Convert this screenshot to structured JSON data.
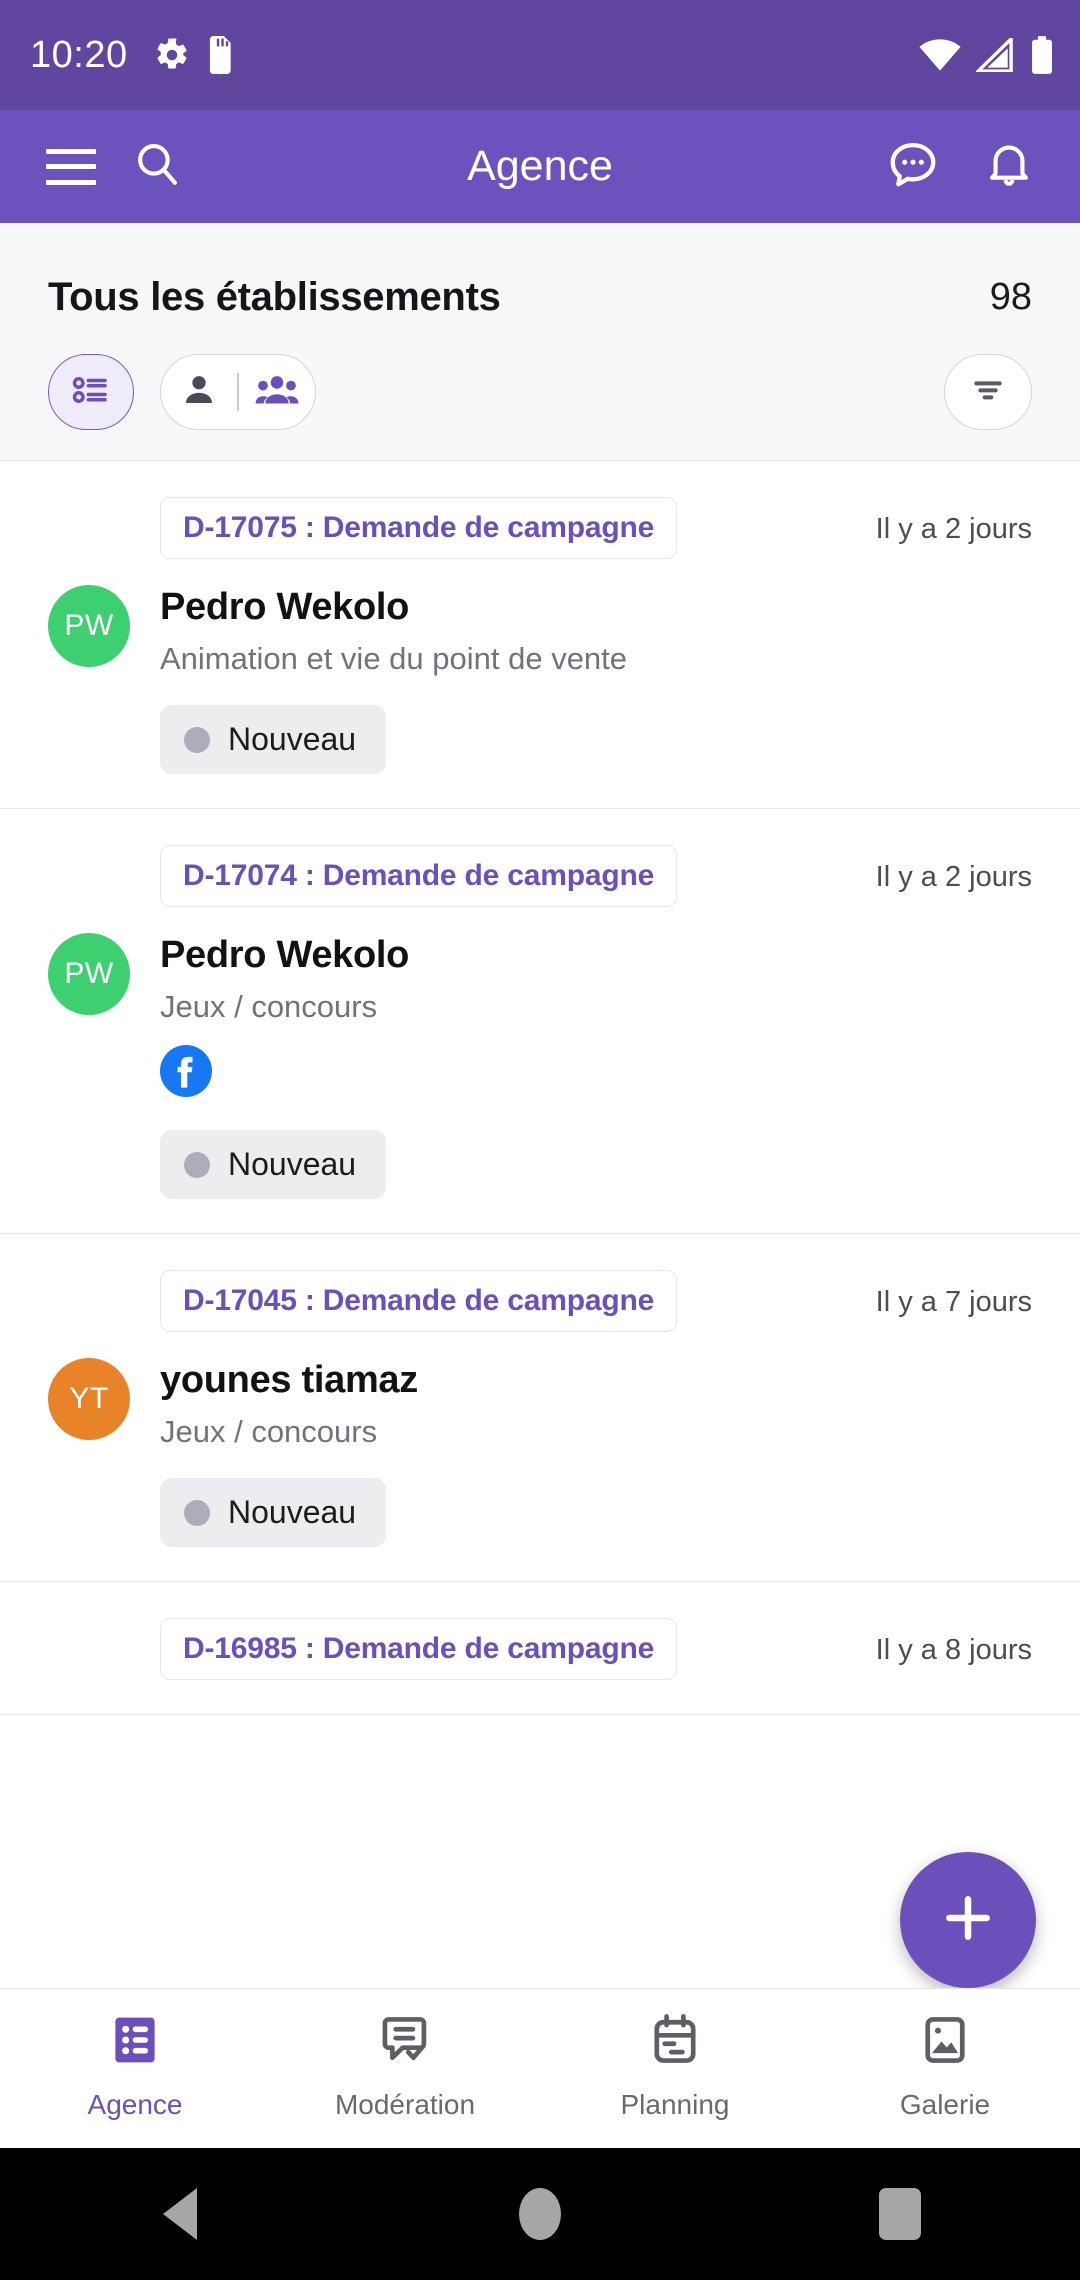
{
  "status_bar": {
    "time": "10:20",
    "icons": [
      "settings-gear-icon",
      "sd-card-icon"
    ],
    "right_icons": [
      "wifi-icon",
      "cellular-signal-icon",
      "battery-icon"
    ]
  },
  "app_bar": {
    "title": "Agence",
    "menu_icon": "hamburger-menu-icon",
    "search_icon": "search-icon",
    "chat_icon": "chat-bubble-icon",
    "notifications_icon": "bell-icon"
  },
  "list_header": {
    "title": "Tous les établissements",
    "count": "98",
    "chips": {
      "listview_icon": "list-view-icon",
      "person_icon": "person-icon",
      "group_icon": "group-icon",
      "filter_icon": "filter-sort-icon"
    }
  },
  "items": [
    {
      "reference": "D-17075 : Demande de campagne",
      "time": "Il y a 2 jours",
      "avatar_initials": "PW",
      "avatar_color": "#3ECF70",
      "name": "Pedro Wekolo",
      "category": "Animation et vie du point de vente",
      "socials": [],
      "status": "Nouveau",
      "status_color": "#ADADBA"
    },
    {
      "reference": "D-17074 : Demande de campagne",
      "time": "Il y a 2 jours",
      "avatar_initials": "PW",
      "avatar_color": "#3ECF70",
      "name": "Pedro Wekolo",
      "category": "Jeux / concours",
      "socials": [
        "facebook-icon"
      ],
      "status": "Nouveau",
      "status_color": "#ADADBA"
    },
    {
      "reference": "D-17045 : Demande de campagne",
      "time": "Il y a 7 jours",
      "avatar_initials": "YT",
      "avatar_color": "#E8832A",
      "name": "younes tiamaz",
      "category": "Jeux / concours",
      "socials": [],
      "status": "Nouveau",
      "status_color": "#ADADBA"
    },
    {
      "reference": "D-16985 : Demande de campagne",
      "time": "Il y a 8 jours",
      "avatar_initials": "",
      "avatar_color": "#3ECF70",
      "name": "",
      "category": "",
      "socials": [],
      "status": "",
      "status_color": "#ADADBA"
    }
  ],
  "fab": {
    "icon": "plus-icon"
  },
  "bottom_nav": {
    "items": [
      {
        "label": "Agence",
        "icon": "list-icon",
        "active": true
      },
      {
        "label": "Modération",
        "icon": "comment-check-icon",
        "active": false
      },
      {
        "label": "Planning",
        "icon": "calendar-icon",
        "active": false
      },
      {
        "label": "Galerie",
        "icon": "image-icon",
        "active": false
      }
    ]
  },
  "android_nav": {
    "back": "back-triangle-icon",
    "home": "home-circle-icon",
    "recents": "recents-square-icon"
  },
  "colors": {
    "status_bar": "#60469E",
    "app_bar": "#6B52BC",
    "accent": "#6B4FBB",
    "header_bg": "#F7F8FA",
    "facebook": "#1877F2"
  }
}
